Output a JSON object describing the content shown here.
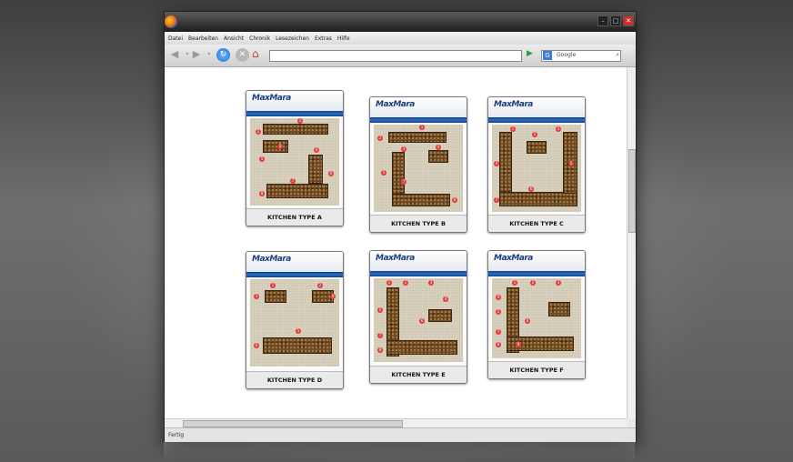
{
  "menu": [
    "Datei",
    "Bearbeiten",
    "Ansicht",
    "Chronik",
    "Lesezeichen",
    "Extras",
    "Hilfe"
  ],
  "search": {
    "placeholder": "Google"
  },
  "status": "Fertig",
  "brand": "MaxMara",
  "cards": [
    {
      "label": "KITCHEN TYPE A"
    },
    {
      "label": "KITCHEN TYPE B"
    },
    {
      "label": "KITCHEN TYPE C"
    },
    {
      "label": "KITCHEN TYPE D"
    },
    {
      "label": "KITCHEN TYPE E"
    },
    {
      "label": "KITCHEN TYPE F"
    }
  ]
}
